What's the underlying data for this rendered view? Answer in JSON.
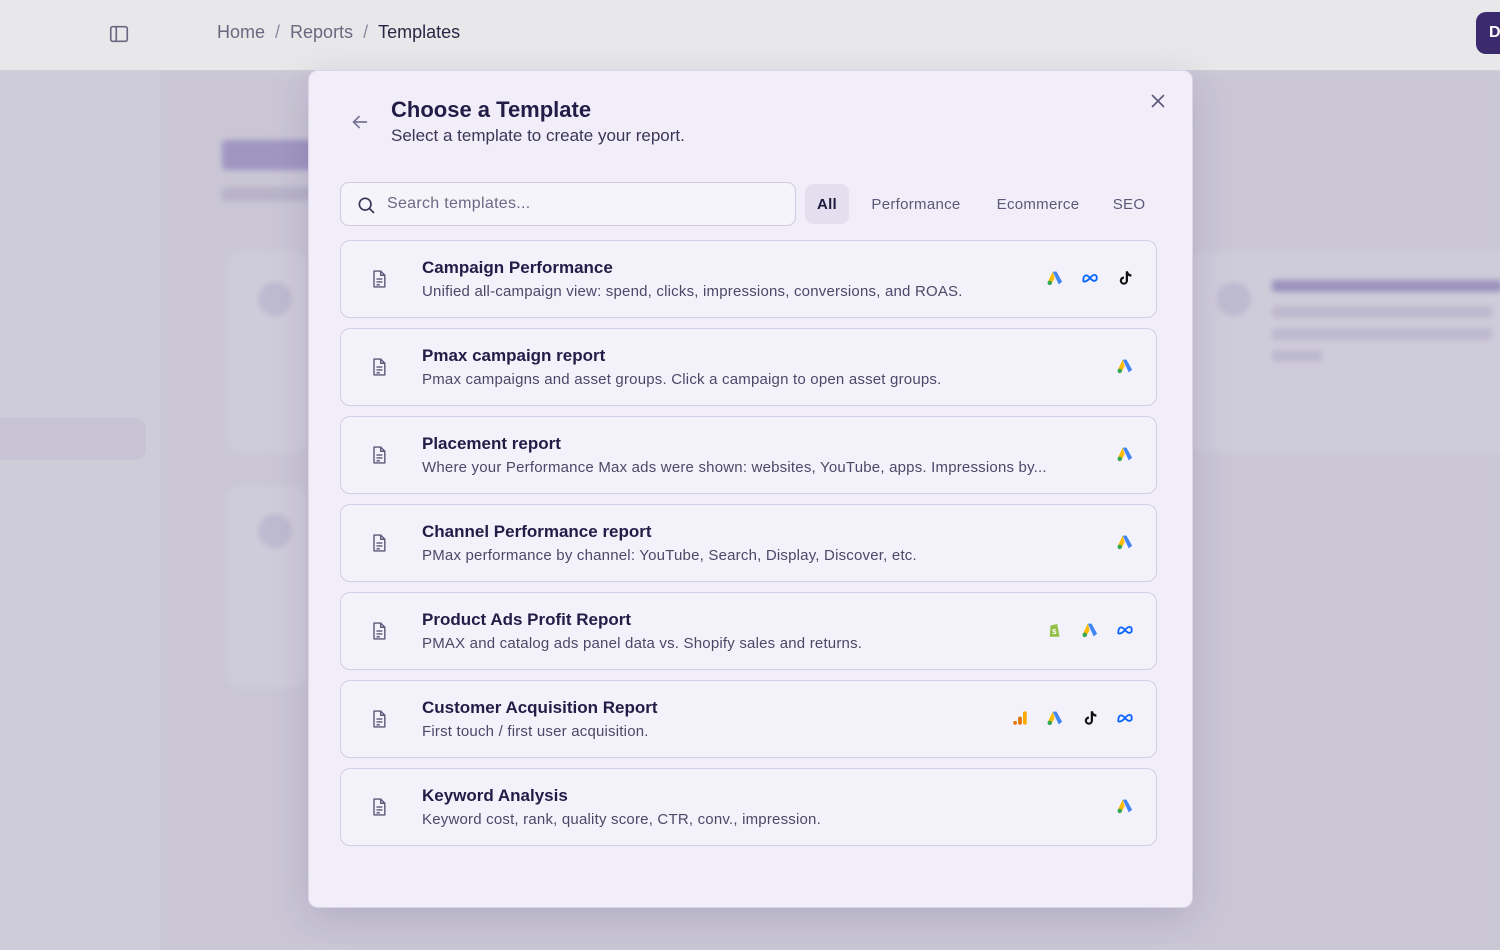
{
  "breadcrumb": {
    "items": [
      "Home",
      "Reports",
      "Templates"
    ]
  },
  "avatar": {
    "initial": "D"
  },
  "modal": {
    "title": "Choose a Template",
    "subtitle": "Select a template to create your report.",
    "search": {
      "placeholder": "Search templates...",
      "value": ""
    },
    "filters": [
      "All",
      "Performance",
      "Ecommerce",
      "SEO"
    ],
    "active_filter": "All",
    "templates": [
      {
        "title": "Campaign Performance",
        "description": "Unified all-campaign view: spend, clicks, impressions, conversions, and ROAS.",
        "sources": [
          "google-ads",
          "meta",
          "tiktok"
        ]
      },
      {
        "title": "Pmax campaign report",
        "description": "Pmax campaigns and asset groups. Click a campaign to open asset groups.",
        "sources": [
          "google-ads"
        ]
      },
      {
        "title": "Placement report",
        "description": "Where your Performance Max ads were shown: websites, YouTube, apps. Impressions by...",
        "sources": [
          "google-ads"
        ]
      },
      {
        "title": "Channel Performance report",
        "description": "PMax performance by channel: YouTube, Search, Display, Discover, etc.",
        "sources": [
          "google-ads"
        ]
      },
      {
        "title": "Product Ads Profit Report",
        "description": "PMAX and catalog ads panel data vs. Shopify sales and returns.",
        "sources": [
          "shopify",
          "google-ads",
          "meta"
        ]
      },
      {
        "title": "Customer Acquisition Report",
        "description": "First touch / first user acquisition.",
        "sources": [
          "google-analytics",
          "google-ads",
          "tiktok",
          "meta"
        ]
      },
      {
        "title": "Keyword Analysis",
        "description": "Keyword cost, rank, quality score, CTR, conv., impression.",
        "sources": [
          "google-ads"
        ]
      }
    ]
  },
  "colors": {
    "accent": "#3b2a6e",
    "modal_bg": "#f1eef9",
    "google_blue": "#4285F4",
    "google_yellow": "#FBBC04",
    "google_green": "#34A853",
    "meta_blue": "#0866FF",
    "shopify_green": "#95BF47"
  }
}
